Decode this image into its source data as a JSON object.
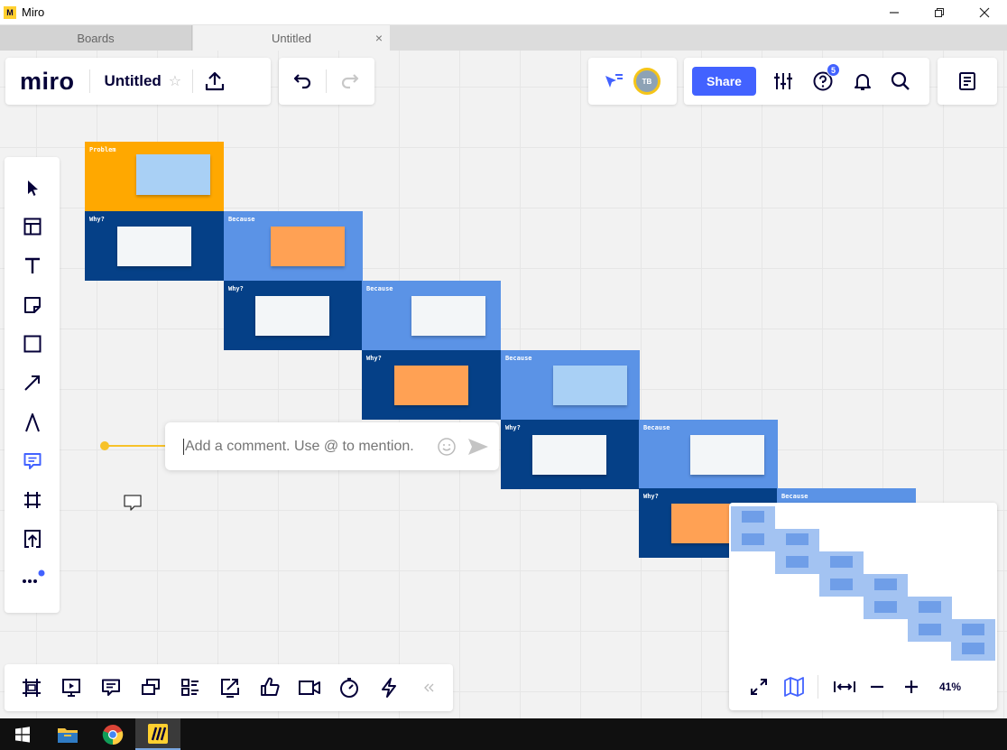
{
  "window": {
    "title": "Miro",
    "app_icon": "miro-logo-icon",
    "controls": [
      "minimize-icon",
      "restore-icon",
      "close-icon"
    ]
  },
  "tabs": [
    {
      "label": "Boards"
    },
    {
      "label": "Untitled",
      "close": "×"
    }
  ],
  "header": {
    "logo": "miro",
    "board_name": "Untitled",
    "share_label": "Share",
    "notifications_count": "5",
    "avatar_initials": "TB"
  },
  "left_tools": [
    "cursor-icon",
    "templates-icon",
    "text-icon",
    "sticky-note-icon",
    "shape-icon",
    "pen-arrow-icon",
    "pen-icon",
    "comment-icon",
    "frame-icon",
    "upload-icon",
    "more-icon"
  ],
  "bottom_tools": [
    "frames-icon",
    "presentation-icon",
    "comments-icon",
    "cards-icon",
    "kanban-icon",
    "screen-share-icon",
    "voting-icon",
    "video-chat-icon",
    "timer-icon",
    "lightning-icon",
    "collapse-icon"
  ],
  "board": {
    "labels": {
      "problem": "Problem",
      "why": "Why?",
      "because": "Because"
    }
  },
  "comment": {
    "placeholder": "Add a comment. Use @ to mention."
  },
  "minimap": {
    "zoom": "41%"
  },
  "colors": {
    "accent": "#4262ff",
    "frame_dark": "#054087",
    "frame_light": "#5b93e6",
    "problem_orange": "#ffa800",
    "sticky_orange": "#ffa154",
    "sticky_white": "#f3f6f8",
    "sticky_lightblue": "#a9d0f5"
  }
}
